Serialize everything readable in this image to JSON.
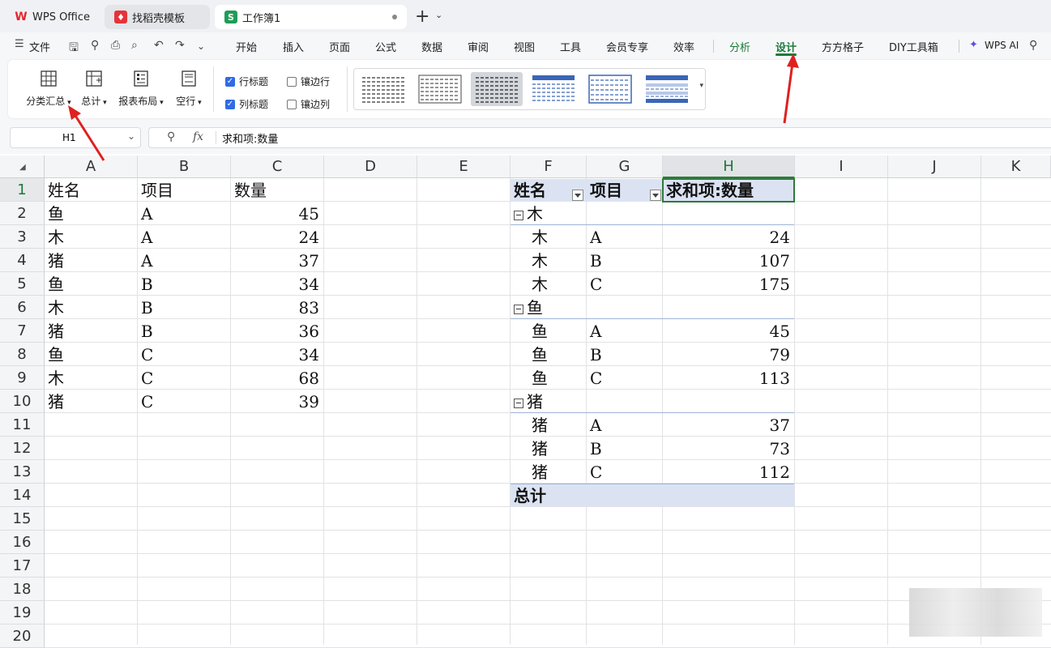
{
  "tabs": [
    {
      "label": "WPS Office",
      "icon": "wps-logo-icon"
    },
    {
      "label": "找稻壳模板",
      "icon": "docer-icon"
    },
    {
      "label": "工作簿1",
      "icon": "spreadsheet-s-icon",
      "active": true
    }
  ],
  "menu": {
    "file": "文件",
    "items": [
      "开始",
      "插入",
      "页面",
      "公式",
      "数据",
      "审阅",
      "视图",
      "工具",
      "会员专享",
      "效率",
      "分析",
      "设计",
      "方方格子",
      "DIY工具箱"
    ],
    "active": "设计",
    "ai": "WPS AI"
  },
  "ribbon": {
    "buttons": [
      "分类汇总",
      "总计",
      "报表布局",
      "空行"
    ],
    "checkboxes": [
      {
        "label": "行标题",
        "checked": true
      },
      {
        "label": "镶边行",
        "checked": false
      },
      {
        "label": "列标题",
        "checked": true
      },
      {
        "label": "镶边列",
        "checked": false
      }
    ]
  },
  "formula_bar": {
    "name_box": "H1",
    "fx": "fx",
    "content": "求和项:数量"
  },
  "columns": [
    "A",
    "B",
    "C",
    "D",
    "E",
    "F",
    "G",
    "H",
    "I",
    "J",
    "K"
  ],
  "selected_column": "H",
  "rows": [
    "1",
    "2",
    "3",
    "4",
    "5",
    "6",
    "7",
    "8",
    "9",
    "10",
    "11",
    "12",
    "13",
    "14",
    "15",
    "16",
    "17",
    "18",
    "19",
    "20"
  ],
  "selected_row": "1",
  "source_table": {
    "headers": [
      "姓名",
      "项目",
      "数量"
    ],
    "rows": [
      [
        "鱼",
        "A",
        "45"
      ],
      [
        "木",
        "A",
        "24"
      ],
      [
        "猪",
        "A",
        "37"
      ],
      [
        "鱼",
        "B",
        "34"
      ],
      [
        "木",
        "B",
        "83"
      ],
      [
        "猪",
        "B",
        "36"
      ],
      [
        "鱼",
        "C",
        "34"
      ],
      [
        "木",
        "C",
        "68"
      ],
      [
        "猪",
        "C",
        "39"
      ]
    ]
  },
  "pivot": {
    "headers": [
      "姓名",
      "项目",
      "求和项:数量"
    ],
    "groups": [
      {
        "name": "木",
        "rows": [
          [
            "木",
            "A",
            "24"
          ],
          [
            "木",
            "B",
            "107"
          ],
          [
            "木",
            "C",
            "175"
          ]
        ]
      },
      {
        "name": "鱼",
        "rows": [
          [
            "鱼",
            "A",
            "45"
          ],
          [
            "鱼",
            "B",
            "79"
          ],
          [
            "鱼",
            "C",
            "113"
          ]
        ]
      },
      {
        "name": "猪",
        "rows": [
          [
            "猪",
            "A",
            "37"
          ],
          [
            "猪",
            "B",
            "73"
          ],
          [
            "猪",
            "C",
            "112"
          ]
        ]
      }
    ],
    "total_label": "总计"
  },
  "colors": {
    "accent_green": "#1a7a3a",
    "pivot_header": "#dbe3f3",
    "arrow": "#e02020"
  }
}
